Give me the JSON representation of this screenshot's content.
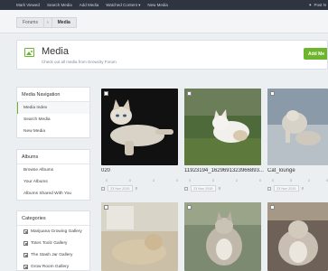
{
  "topnav": {
    "items": [
      "Mark Viewed",
      "Search Media",
      "Add Media",
      "Watched Content ▾",
      "New Media"
    ],
    "right_label": "Post N"
  },
  "breadcrumbs": {
    "forums": "Forums",
    "separator": "›",
    "current": "Media"
  },
  "page": {
    "title": "Media",
    "subtitle": "Check out all media from Growcity Forum",
    "add_button": "Add Me"
  },
  "sidebar": {
    "navigation": {
      "title": "Media Navigation",
      "items": [
        {
          "label": "Media Index",
          "active": true
        },
        {
          "label": "Search Media",
          "active": false
        },
        {
          "label": "New Media",
          "active": false
        }
      ]
    },
    "albums": {
      "title": "Albums",
      "items": [
        "Browse Albums",
        "Your Albums",
        "Albums Shared With You"
      ]
    },
    "categories": {
      "title": "Categories",
      "items": [
        "Marijuana Growing Gallery",
        "Totes Toolz Gallery",
        "The Stash Jar Gallery",
        "Grow Room Gallery"
      ]
    }
  },
  "media": [
    {
      "title": "020",
      "comments": "0",
      "likes": "0",
      "views": "2",
      "rating": "0",
      "date": "23 Nov 2015"
    },
    {
      "title": "11923194_1629691323966893...",
      "comments": "0",
      "likes": "0",
      "views": "2",
      "rating": "0",
      "date": "23 Nov 2015"
    },
    {
      "title": "Cat_lounge",
      "comments": "0",
      "likes": "0",
      "views": "2",
      "rating": "0",
      "date": "23 Nov 2015"
    },
    {
      "title": "",
      "comments": "",
      "likes": "",
      "views": "",
      "rating": "",
      "date": ""
    },
    {
      "title": "",
      "comments": "",
      "likes": "",
      "views": "",
      "rating": "",
      "date": ""
    },
    {
      "title": "",
      "comments": "",
      "likes": "",
      "views": "",
      "rating": "",
      "date": ""
    }
  ],
  "colors": {
    "accent": "#6cb52d",
    "topnav": "#2e3440",
    "background": "#eceff1"
  }
}
